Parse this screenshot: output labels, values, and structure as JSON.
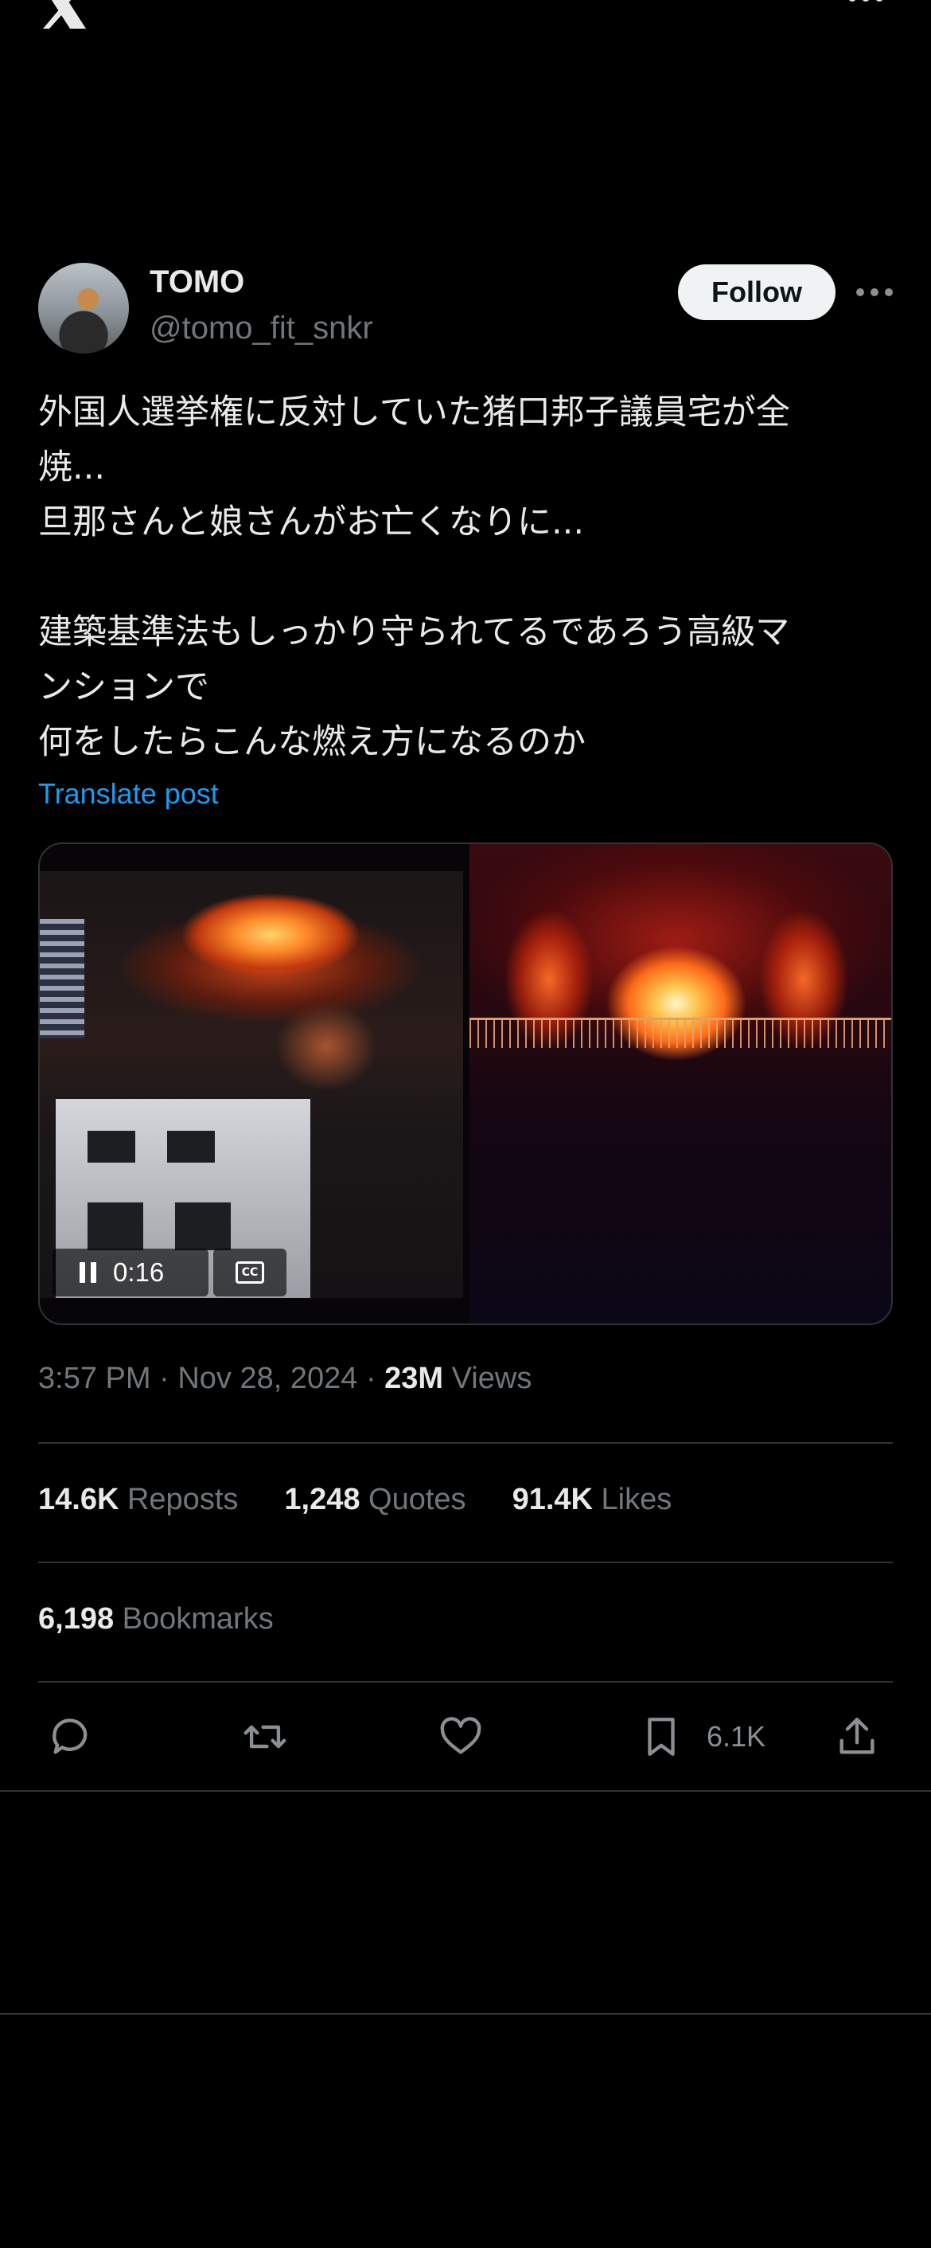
{
  "header": {
    "logo_icon": "x-logo-icon",
    "more_icon": "more-horizontal-icon"
  },
  "post": {
    "author": {
      "name": "TOMO",
      "handle": "@tomo_fit_snkr"
    },
    "follow_label": "Follow",
    "body_lines": [
      "外国人選挙権に反対していた猪口邦子議員宅が全",
      "焼...",
      "旦那さんと娘さんがお亡くなりに...",
      "",
      "建築基準法もしっかり守られてるであろう高級マ",
      "ンションで",
      "何をしたらこんな燃え方になるのか"
    ],
    "translate_label": "Translate post",
    "media": {
      "time": "0:16",
      "cc_label": "CC"
    },
    "meta": {
      "time": "3:57 PM",
      "separator": "·",
      "date": "Nov 28, 2024",
      "views_count": "23M",
      "views_label": "Views"
    },
    "stats": {
      "reposts_count": "14.6K",
      "reposts_label": "Reposts",
      "quotes_count": "1,248",
      "quotes_label": "Quotes",
      "likes_count": "91.4K",
      "likes_label": "Likes",
      "bookmarks_count": "6,198",
      "bookmarks_label": "Bookmarks"
    },
    "actions": {
      "reply_icon": "reply-icon",
      "repost_icon": "repost-icon",
      "like_icon": "heart-icon",
      "bookmark_icon": "bookmark-icon",
      "bookmark_count": "6.1K",
      "share_icon": "share-icon"
    }
  },
  "colors": {
    "background": "#000000",
    "text": "#e7e9ea",
    "secondary": "#71767b",
    "link": "#1d9bf0",
    "border": "#2f3336",
    "follow_bg": "#eff3f4"
  }
}
